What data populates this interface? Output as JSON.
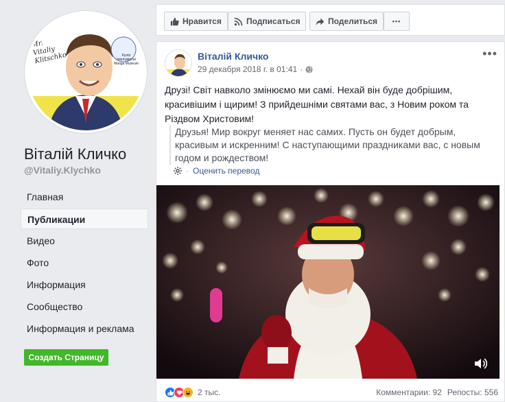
{
  "sidebar": {
    "page_name": "Віталій Кличко",
    "handle": "@Vitaliy.Klychko",
    "avatar_caption": "Mr. Vitaliy Klitschko",
    "avatar_stamp": "Kyoto International Manga Museum",
    "nav": [
      {
        "label": "Главная",
        "active": false
      },
      {
        "label": "Публикации",
        "active": true
      },
      {
        "label": "Видео",
        "active": false
      },
      {
        "label": "Фото",
        "active": false
      },
      {
        "label": "Информация",
        "active": false
      },
      {
        "label": "Сообщество",
        "active": false
      },
      {
        "label": "Информация и реклама",
        "active": false
      }
    ],
    "create_button": "Создать Страницу"
  },
  "actions": {
    "like": "Нравится",
    "subscribe": "Подписаться",
    "share": "Поделиться",
    "more": "•••"
  },
  "post": {
    "author": "Віталій Кличко",
    "timestamp": "29 декабря 2018 г. в 01:41",
    "text": "Друзі! Світ навколо змінюємо ми самі. Нехай він буде добрішим, красивішим і щирим! З прийдешніми святами вас, з Новим роком та Різдвом Христовим!",
    "translation": "Друзья! Мир вокруг меняет нас самих. Пусть он будет добрым, красивым и искренним! С наступающими праздниками вас, с новым годом и рождеством!",
    "rate_link": "Оценить перевод",
    "reactions_count": "2 тыс.",
    "comments": "Комментарии: 92",
    "reposts": "Репосты: 556"
  },
  "colors": {
    "link": "#365899",
    "create_button": "#42b72a",
    "like_reaction": "#1877f2",
    "love_reaction": "#f33e58",
    "haha_reaction": "#f7b125"
  }
}
